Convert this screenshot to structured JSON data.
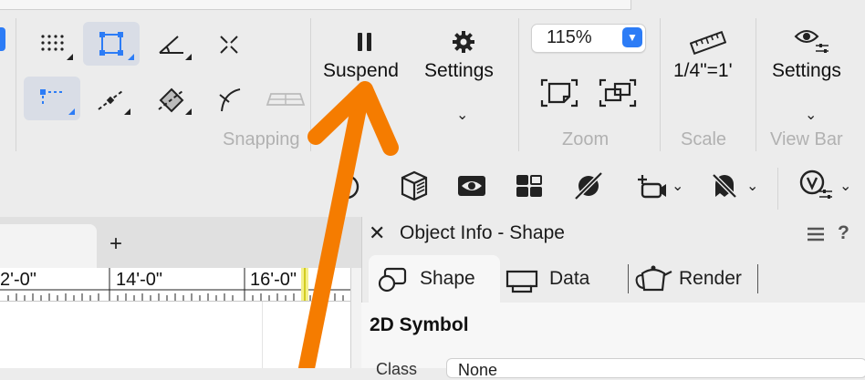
{
  "toolbar": {
    "snapping_label": "Snapping",
    "suspend_label": "Suspend",
    "settings_label": "Settings",
    "zoom": {
      "value": "115%",
      "group_label": "Zoom"
    },
    "scale": {
      "value": "1/4\"=1'",
      "group_label": "Scale"
    },
    "viewbar": {
      "settings_label": "Settings",
      "group_label": "View Bar"
    }
  },
  "canvas": {
    "new_tab_label": "+",
    "ruler_labels": [
      "2'-0\"",
      "14'-0\"",
      "16'-0\""
    ]
  },
  "object_info": {
    "title": "Object Info - Shape",
    "tabs": [
      {
        "label": "Shape",
        "active": true
      },
      {
        "label": "Data",
        "active": false
      },
      {
        "label": "Render",
        "active": false
      }
    ],
    "section_title": "2D Symbol",
    "class_label": "Class",
    "class_value": "None"
  },
  "colors": {
    "accent": "#2c7cf6",
    "annotation_arrow": "#f57c00"
  }
}
